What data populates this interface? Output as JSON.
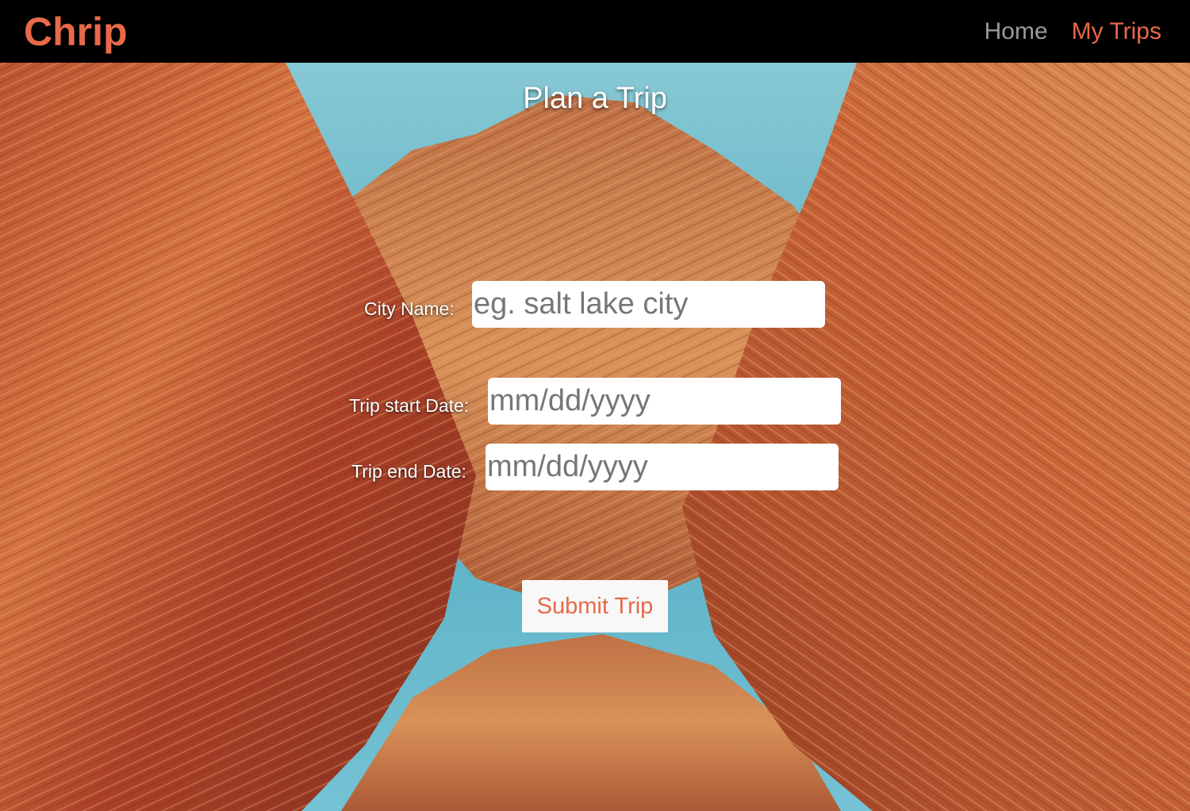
{
  "navbar": {
    "brand": "Chrip",
    "links": [
      {
        "label": "Home",
        "active": false
      },
      {
        "label": "My Trips",
        "active": true
      }
    ]
  },
  "main": {
    "title": "Plan a Trip",
    "form": {
      "city": {
        "label": "City Name:",
        "placeholder": "eg. salt lake city",
        "value": ""
      },
      "start_date": {
        "label": "Trip start Date:",
        "placeholder": "mm/dd/yyyy",
        "value": ""
      },
      "end_date": {
        "label": "Trip end Date:",
        "placeholder": "mm/dd/yyyy",
        "value": ""
      },
      "submit_label": "Submit Trip"
    },
    "background": "canyon-landscape-photo"
  },
  "colors": {
    "accent": "#e8694a",
    "navbar_bg": "#000000",
    "nav_inactive": "#9a9a9a"
  }
}
